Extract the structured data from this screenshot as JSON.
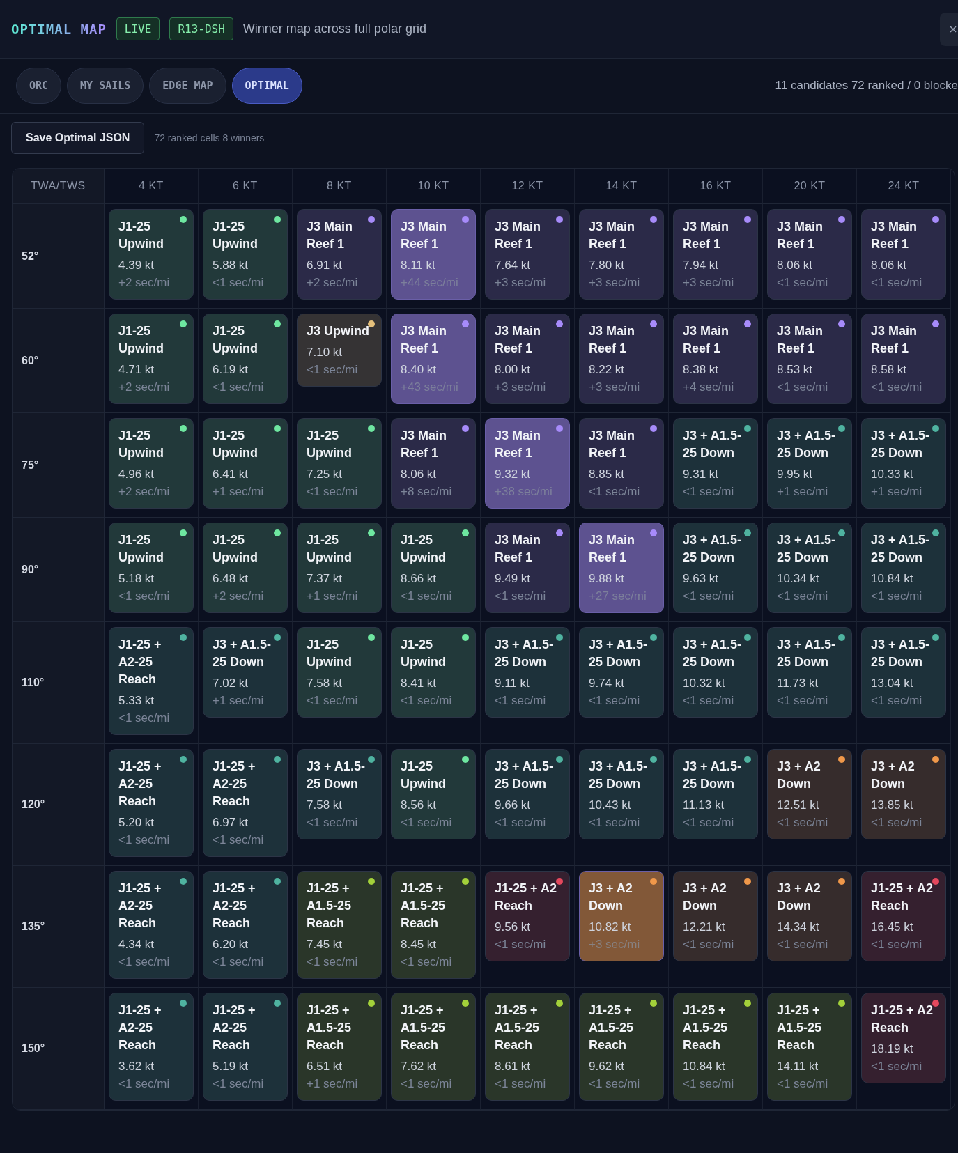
{
  "header": {
    "title": "OPTIMAL MAP",
    "badges": [
      {
        "label": "LIVE"
      },
      {
        "label": "R13-DSH"
      }
    ],
    "subtitle": "Winner map across full polar grid"
  },
  "tabs": [
    {
      "label": "ORC",
      "selected": false
    },
    {
      "label": "MY SAILS",
      "selected": false
    },
    {
      "label": "EDGE MAP",
      "selected": false
    },
    {
      "label": "OPTIMAL",
      "selected": true
    }
  ],
  "status": "11 candidates 72 ranked / 0 blocke",
  "toolbar": {
    "save_button": "Save Optimal JSON",
    "summary": "72 ranked cells 8 winners"
  },
  "grid": {
    "corner": "TWA/TWS",
    "columns": [
      "4 KT",
      "6 KT",
      "8 KT",
      "10 KT",
      "12 KT",
      "14 KT",
      "16 KT",
      "20 KT",
      "24 KT"
    ],
    "rows": [
      {
        "angle": "52°",
        "cells": [
          {
            "sail": "J1-25 Upwind",
            "speed": "4.39 kt",
            "delta": "+2 sec/mi",
            "color": "#6ee7a0",
            "highlight": false
          },
          {
            "sail": "J1-25 Upwind",
            "speed": "5.88 kt",
            "delta": "<1 sec/mi",
            "color": "#6ee7a0",
            "highlight": false
          },
          {
            "sail": "J3 Main Reef 1",
            "speed": "6.91 kt",
            "delta": "+2 sec/mi",
            "color": "#a78bfa",
            "highlight": false
          },
          {
            "sail": "J3 Main Reef 1",
            "speed": "8.11 kt",
            "delta": "+44 sec/mi",
            "color": "#a78bfa",
            "highlight": true
          },
          {
            "sail": "J3 Main Reef 1",
            "speed": "7.64 kt",
            "delta": "+3 sec/mi",
            "color": "#a78bfa",
            "highlight": false
          },
          {
            "sail": "J3 Main Reef 1",
            "speed": "7.80 kt",
            "delta": "+3 sec/mi",
            "color": "#a78bfa",
            "highlight": false
          },
          {
            "sail": "J3 Main Reef 1",
            "speed": "7.94 kt",
            "delta": "+3 sec/mi",
            "color": "#a78bfa",
            "highlight": false
          },
          {
            "sail": "J3 Main Reef 1",
            "speed": "8.06 kt",
            "delta": "<1 sec/mi",
            "color": "#a78bfa",
            "highlight": false
          },
          {
            "sail": "J3 Main Reef 1",
            "speed": "8.06 kt",
            "delta": "<1 sec/mi",
            "color": "#a78bfa",
            "highlight": false
          }
        ]
      },
      {
        "angle": "60°",
        "cells": [
          {
            "sail": "J1-25 Upwind",
            "speed": "4.71 kt",
            "delta": "+2 sec/mi",
            "color": "#6ee7a0",
            "highlight": false
          },
          {
            "sail": "J1-25 Upwind",
            "speed": "6.19 kt",
            "delta": "<1 sec/mi",
            "color": "#6ee7a0",
            "highlight": false
          },
          {
            "sail": "J3 Upwind",
            "speed": "7.10 kt",
            "delta": "<1 sec/mi",
            "color": "#e5c07b",
            "highlight": false
          },
          {
            "sail": "J3 Main Reef 1",
            "speed": "8.40 kt",
            "delta": "+43 sec/mi",
            "color": "#a78bfa",
            "highlight": true
          },
          {
            "sail": "J3 Main Reef 1",
            "speed": "8.00 kt",
            "delta": "+3 sec/mi",
            "color": "#a78bfa",
            "highlight": false
          },
          {
            "sail": "J3 Main Reef 1",
            "speed": "8.22 kt",
            "delta": "+3 sec/mi",
            "color": "#a78bfa",
            "highlight": false
          },
          {
            "sail": "J3 Main Reef 1",
            "speed": "8.38 kt",
            "delta": "+4 sec/mi",
            "color": "#a78bfa",
            "highlight": false
          },
          {
            "sail": "J3 Main Reef 1",
            "speed": "8.53 kt",
            "delta": "<1 sec/mi",
            "color": "#a78bfa",
            "highlight": false
          },
          {
            "sail": "J3 Main Reef 1",
            "speed": "8.58 kt",
            "delta": "<1 sec/mi",
            "color": "#a78bfa",
            "highlight": false
          }
        ]
      },
      {
        "angle": "75°",
        "cells": [
          {
            "sail": "J1-25 Upwind",
            "speed": "4.96 kt",
            "delta": "+2 sec/mi",
            "color": "#6ee7a0",
            "highlight": false
          },
          {
            "sail": "J1-25 Upwind",
            "speed": "6.41 kt",
            "delta": "+1 sec/mi",
            "color": "#6ee7a0",
            "highlight": false
          },
          {
            "sail": "J1-25 Upwind",
            "speed": "7.25 kt",
            "delta": "<1 sec/mi",
            "color": "#6ee7a0",
            "highlight": false
          },
          {
            "sail": "J3 Main Reef 1",
            "speed": "8.06 kt",
            "delta": "+8 sec/mi",
            "color": "#a78bfa",
            "highlight": false
          },
          {
            "sail": "J3 Main Reef 1",
            "speed": "9.32 kt",
            "delta": "+38 sec/mi",
            "color": "#a78bfa",
            "highlight": true
          },
          {
            "sail": "J3 Main Reef 1",
            "speed": "8.85 kt",
            "delta": "<1 sec/mi",
            "color": "#a78bfa",
            "highlight": false
          },
          {
            "sail": "J3 + A1.5-25 Down",
            "speed": "9.31 kt",
            "delta": "<1 sec/mi",
            "color": "#4fb3a0",
            "highlight": false
          },
          {
            "sail": "J3 + A1.5-25 Down",
            "speed": "9.95 kt",
            "delta": "+1 sec/mi",
            "color": "#4fb3a0",
            "highlight": false
          },
          {
            "sail": "J3 + A1.5-25 Down",
            "speed": "10.33 kt",
            "delta": "+1 sec/mi",
            "color": "#4fb3a0",
            "highlight": false
          }
        ]
      },
      {
        "angle": "90°",
        "cells": [
          {
            "sail": "J1-25 Upwind",
            "speed": "5.18 kt",
            "delta": "<1 sec/mi",
            "color": "#6ee7a0",
            "highlight": false
          },
          {
            "sail": "J1-25 Upwind",
            "speed": "6.48 kt",
            "delta": "+2 sec/mi",
            "color": "#6ee7a0",
            "highlight": false
          },
          {
            "sail": "J1-25 Upwind",
            "speed": "7.37 kt",
            "delta": "+1 sec/mi",
            "color": "#6ee7a0",
            "highlight": false
          },
          {
            "sail": "J1-25 Upwind",
            "speed": "8.66 kt",
            "delta": "<1 sec/mi",
            "color": "#6ee7a0",
            "highlight": false
          },
          {
            "sail": "J3 Main Reef 1",
            "speed": "9.49 kt",
            "delta": "<1 sec/mi",
            "color": "#a78bfa",
            "highlight": false
          },
          {
            "sail": "J3 Main Reef 1",
            "speed": "9.88 kt",
            "delta": "+27 sec/mi",
            "color": "#a78bfa",
            "highlight": true
          },
          {
            "sail": "J3 + A1.5-25 Down",
            "speed": "9.63 kt",
            "delta": "<1 sec/mi",
            "color": "#4fb3a0",
            "highlight": false
          },
          {
            "sail": "J3 + A1.5-25 Down",
            "speed": "10.34 kt",
            "delta": "<1 sec/mi",
            "color": "#4fb3a0",
            "highlight": false
          },
          {
            "sail": "J3 + A1.5-25 Down",
            "speed": "10.84 kt",
            "delta": "<1 sec/mi",
            "color": "#4fb3a0",
            "highlight": false
          }
        ]
      },
      {
        "angle": "110°",
        "cells": [
          {
            "sail": "J1-25 + A2-25 Reach",
            "speed": "5.33 kt",
            "delta": "<1 sec/mi",
            "color": "#4fb3a0",
            "highlight": false
          },
          {
            "sail": "J3 + A1.5-25 Down",
            "speed": "7.02 kt",
            "delta": "+1 sec/mi",
            "color": "#4fb3a0",
            "highlight": false
          },
          {
            "sail": "J1-25 Upwind",
            "speed": "7.58 kt",
            "delta": "<1 sec/mi",
            "color": "#6ee7a0",
            "highlight": false
          },
          {
            "sail": "J1-25 Upwind",
            "speed": "8.41 kt",
            "delta": "<1 sec/mi",
            "color": "#6ee7a0",
            "highlight": false
          },
          {
            "sail": "J3 + A1.5-25 Down",
            "speed": "9.11 kt",
            "delta": "<1 sec/mi",
            "color": "#4fb3a0",
            "highlight": false
          },
          {
            "sail": "J3 + A1.5-25 Down",
            "speed": "9.74 kt",
            "delta": "<1 sec/mi",
            "color": "#4fb3a0",
            "highlight": false
          },
          {
            "sail": "J3 + A1.5-25 Down",
            "speed": "10.32 kt",
            "delta": "<1 sec/mi",
            "color": "#4fb3a0",
            "highlight": false
          },
          {
            "sail": "J3 + A1.5-25 Down",
            "speed": "11.73 kt",
            "delta": "<1 sec/mi",
            "color": "#4fb3a0",
            "highlight": false
          },
          {
            "sail": "J3 + A1.5-25 Down",
            "speed": "13.04 kt",
            "delta": "<1 sec/mi",
            "color": "#4fb3a0",
            "highlight": false
          }
        ]
      },
      {
        "angle": "120°",
        "cells": [
          {
            "sail": "J1-25 + A2-25 Reach",
            "speed": "5.20 kt",
            "delta": "<1 sec/mi",
            "color": "#4fb3a0",
            "highlight": false
          },
          {
            "sail": "J1-25 + A2-25 Reach",
            "speed": "6.97 kt",
            "delta": "<1 sec/mi",
            "color": "#4fb3a0",
            "highlight": false
          },
          {
            "sail": "J3 + A1.5-25 Down",
            "speed": "7.58 kt",
            "delta": "<1 sec/mi",
            "color": "#4fb3a0",
            "highlight": false
          },
          {
            "sail": "J1-25 Upwind",
            "speed": "8.56 kt",
            "delta": "<1 sec/mi",
            "color": "#6ee7a0",
            "highlight": false
          },
          {
            "sail": "J3 + A1.5-25 Down",
            "speed": "9.66 kt",
            "delta": "<1 sec/mi",
            "color": "#4fb3a0",
            "highlight": false
          },
          {
            "sail": "J3 + A1.5-25 Down",
            "speed": "10.43 kt",
            "delta": "<1 sec/mi",
            "color": "#4fb3a0",
            "highlight": false
          },
          {
            "sail": "J3 + A1.5-25 Down",
            "speed": "11.13 kt",
            "delta": "<1 sec/mi",
            "color": "#4fb3a0",
            "highlight": false
          },
          {
            "sail": "J3 + A2 Down",
            "speed": "12.51 kt",
            "delta": "<1 sec/mi",
            "color": "#f0984a",
            "highlight": false
          },
          {
            "sail": "J3 + A2 Down",
            "speed": "13.85 kt",
            "delta": "<1 sec/mi",
            "color": "#f0984a",
            "highlight": false
          }
        ]
      },
      {
        "angle": "135°",
        "cells": [
          {
            "sail": "J1-25 + A2-25 Reach",
            "speed": "4.34 kt",
            "delta": "<1 sec/mi",
            "color": "#4fb3a0",
            "highlight": false
          },
          {
            "sail": "J1-25 + A2-25 Reach",
            "speed": "6.20 kt",
            "delta": "<1 sec/mi",
            "color": "#4fb3a0",
            "highlight": false
          },
          {
            "sail": "J1-25 + A1.5-25 Reach",
            "speed": "7.45 kt",
            "delta": "<1 sec/mi",
            "color": "#a3d13a",
            "highlight": false
          },
          {
            "sail": "J1-25 + A1.5-25 Reach",
            "speed": "8.45 kt",
            "delta": "<1 sec/mi",
            "color": "#a3d13a",
            "highlight": false
          },
          {
            "sail": "J1-25 + A2 Reach",
            "speed": "9.56 kt",
            "delta": "<1 sec/mi",
            "color": "#e5485d",
            "highlight": false
          },
          {
            "sail": "J3 + A2 Down",
            "speed": "10.82 kt",
            "delta": "+3 sec/mi",
            "color": "#f0984a",
            "highlight": true
          },
          {
            "sail": "J3 + A2 Down",
            "speed": "12.21 kt",
            "delta": "<1 sec/mi",
            "color": "#f0984a",
            "highlight": false
          },
          {
            "sail": "J3 + A2 Down",
            "speed": "14.34 kt",
            "delta": "<1 sec/mi",
            "color": "#f0984a",
            "highlight": false
          },
          {
            "sail": "J1-25 + A2 Reach",
            "speed": "16.45 kt",
            "delta": "<1 sec/mi",
            "color": "#e5485d",
            "highlight": false
          }
        ]
      },
      {
        "angle": "150°",
        "cells": [
          {
            "sail": "J1-25 + A2-25 Reach",
            "speed": "3.62 kt",
            "delta": "<1 sec/mi",
            "color": "#4fb3a0",
            "highlight": false
          },
          {
            "sail": "J1-25 + A2-25 Reach",
            "speed": "5.19 kt",
            "delta": "<1 sec/mi",
            "color": "#4fb3a0",
            "highlight": false
          },
          {
            "sail": "J1-25 + A1.5-25 Reach",
            "speed": "6.51 kt",
            "delta": "+1 sec/mi",
            "color": "#a3d13a",
            "highlight": false
          },
          {
            "sail": "J1-25 + A1.5-25 Reach",
            "speed": "7.62 kt",
            "delta": "<1 sec/mi",
            "color": "#a3d13a",
            "highlight": false
          },
          {
            "sail": "J1-25 + A1.5-25 Reach",
            "speed": "8.61 kt",
            "delta": "<1 sec/mi",
            "color": "#a3d13a",
            "highlight": false
          },
          {
            "sail": "J1-25 + A1.5-25 Reach",
            "speed": "9.62 kt",
            "delta": "<1 sec/mi",
            "color": "#a3d13a",
            "highlight": false
          },
          {
            "sail": "J1-25 + A1.5-25 Reach",
            "speed": "10.84 kt",
            "delta": "<1 sec/mi",
            "color": "#a3d13a",
            "highlight": false
          },
          {
            "sail": "J1-25 + A1.5-25 Reach",
            "speed": "14.11 kt",
            "delta": "<1 sec/mi",
            "color": "#a3d13a",
            "highlight": false
          },
          {
            "sail": "J1-25 + A2 Reach",
            "speed": "18.19 kt",
            "delta": "<1 sec/mi",
            "color": "#e5485d",
            "highlight": false
          }
        ]
      }
    ]
  }
}
